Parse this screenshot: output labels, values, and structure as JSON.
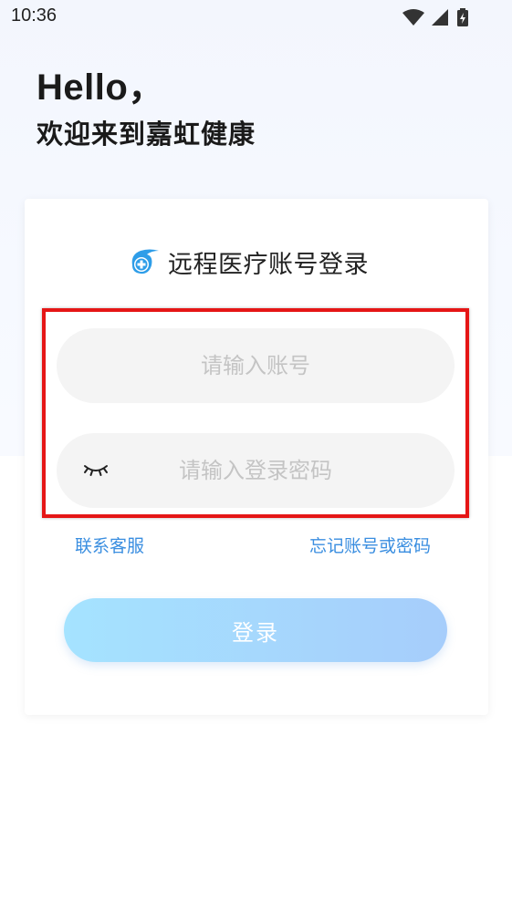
{
  "status_bar": {
    "time": "10:36",
    "icons": [
      "wifi-icon",
      "signal-icon",
      "battery-icon"
    ]
  },
  "greeting": {
    "hello": "Hello，",
    "welcome": "欢迎来到嘉虹健康"
  },
  "login_card": {
    "title": "远程医疗账号登录",
    "logo_icon": "app-logo-icon",
    "account_input": {
      "placeholder": "请输入账号",
      "value": ""
    },
    "password_input": {
      "placeholder": "请输入登录密码",
      "value": "",
      "toggle_icon": "eye-closed-icon"
    },
    "contact_link": "联系客服",
    "forgot_link": "忘记账号或密码",
    "login_button": "登录"
  },
  "colors": {
    "accent": "#3a8ee0",
    "highlight_border": "#e51616",
    "button_gradient_start": "#a5e3ff",
    "button_gradient_end": "#a6cdfb"
  }
}
